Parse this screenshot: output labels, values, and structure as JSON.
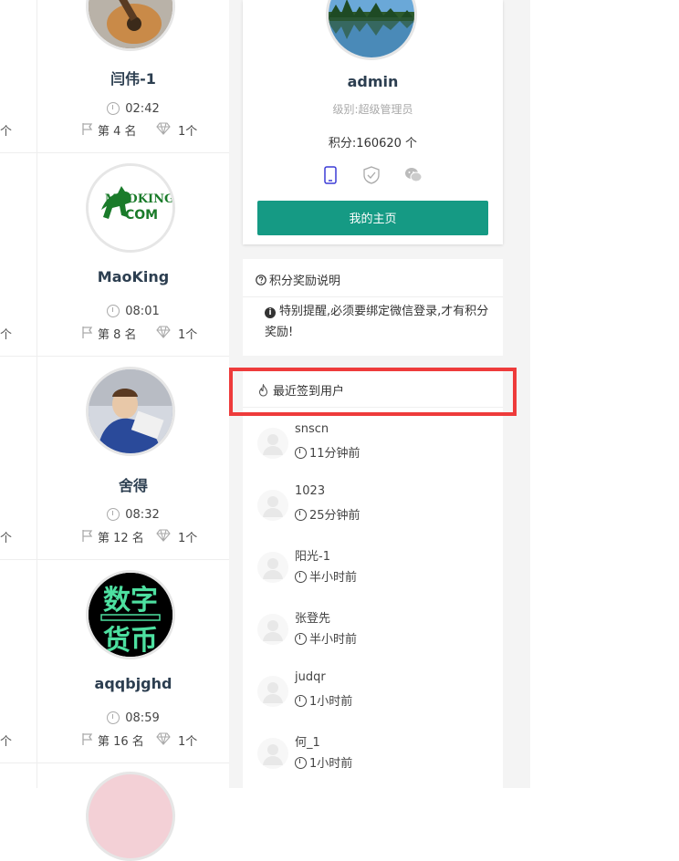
{
  "leaderboard": [
    {
      "name": "闫伟-1",
      "time": "02:42",
      "rank": "第 4 名",
      "count": "1个"
    },
    {
      "name": "MaoKing",
      "time": "08:01",
      "rank": "第 8 名",
      "count": "1个",
      "avatar_text": [
        "MAOKING",
        "COM"
      ]
    },
    {
      "name": "舍得",
      "time": "08:32",
      "rank": "第 12 名",
      "count": "1个"
    },
    {
      "name": "aqqbjghd",
      "time": "08:59",
      "rank": "第 16 名",
      "count": "1个",
      "avatar_text": [
        "数字",
        "货币"
      ]
    }
  ],
  "left_edge_suffix": "个",
  "profile": {
    "name": "admin",
    "level": "级别:超级管理员",
    "points": "积分:160620 个",
    "icons": [
      "mobile-icon",
      "shield-check-icon",
      "wechat-icon"
    ],
    "home_button": "我的主页"
  },
  "reward": {
    "title": "积分奖励说明",
    "notice": "特别提醒,必须要绑定微信登录,才有积分奖励!"
  },
  "recent": {
    "title": "最近签到用户",
    "users": [
      {
        "name": "snscn",
        "ago": "11分钟前"
      },
      {
        "name": "1023",
        "ago": "25分钟前"
      },
      {
        "name": "阳光-1",
        "ago": "半小时前"
      },
      {
        "name": "张登先",
        "ago": "半小时前"
      },
      {
        "name": "judqr",
        "ago": "1小时前"
      },
      {
        "name": "何_1",
        "ago": "1小时前"
      }
    ]
  },
  "colors": {
    "accent": "#159a84",
    "highlight": "#ee3b3b"
  }
}
